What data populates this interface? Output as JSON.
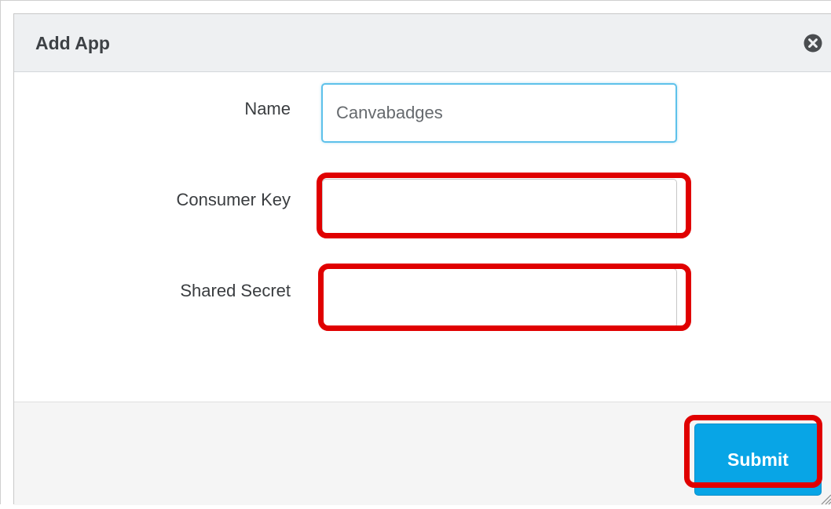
{
  "dialog": {
    "title": "Add App",
    "close_icon": "close-circle-icon"
  },
  "form": {
    "name": {
      "label": "Name",
      "value": "Canvabadges"
    },
    "consumer_key": {
      "label": "Consumer Key",
      "value": ""
    },
    "shared_secret": {
      "label": "Shared Secret",
      "value": ""
    }
  },
  "footer": {
    "submit_label": "Submit"
  },
  "colors": {
    "highlight": "#e00000",
    "submit_bg": "#08a5e6",
    "focus_border": "#5ec1ea"
  }
}
